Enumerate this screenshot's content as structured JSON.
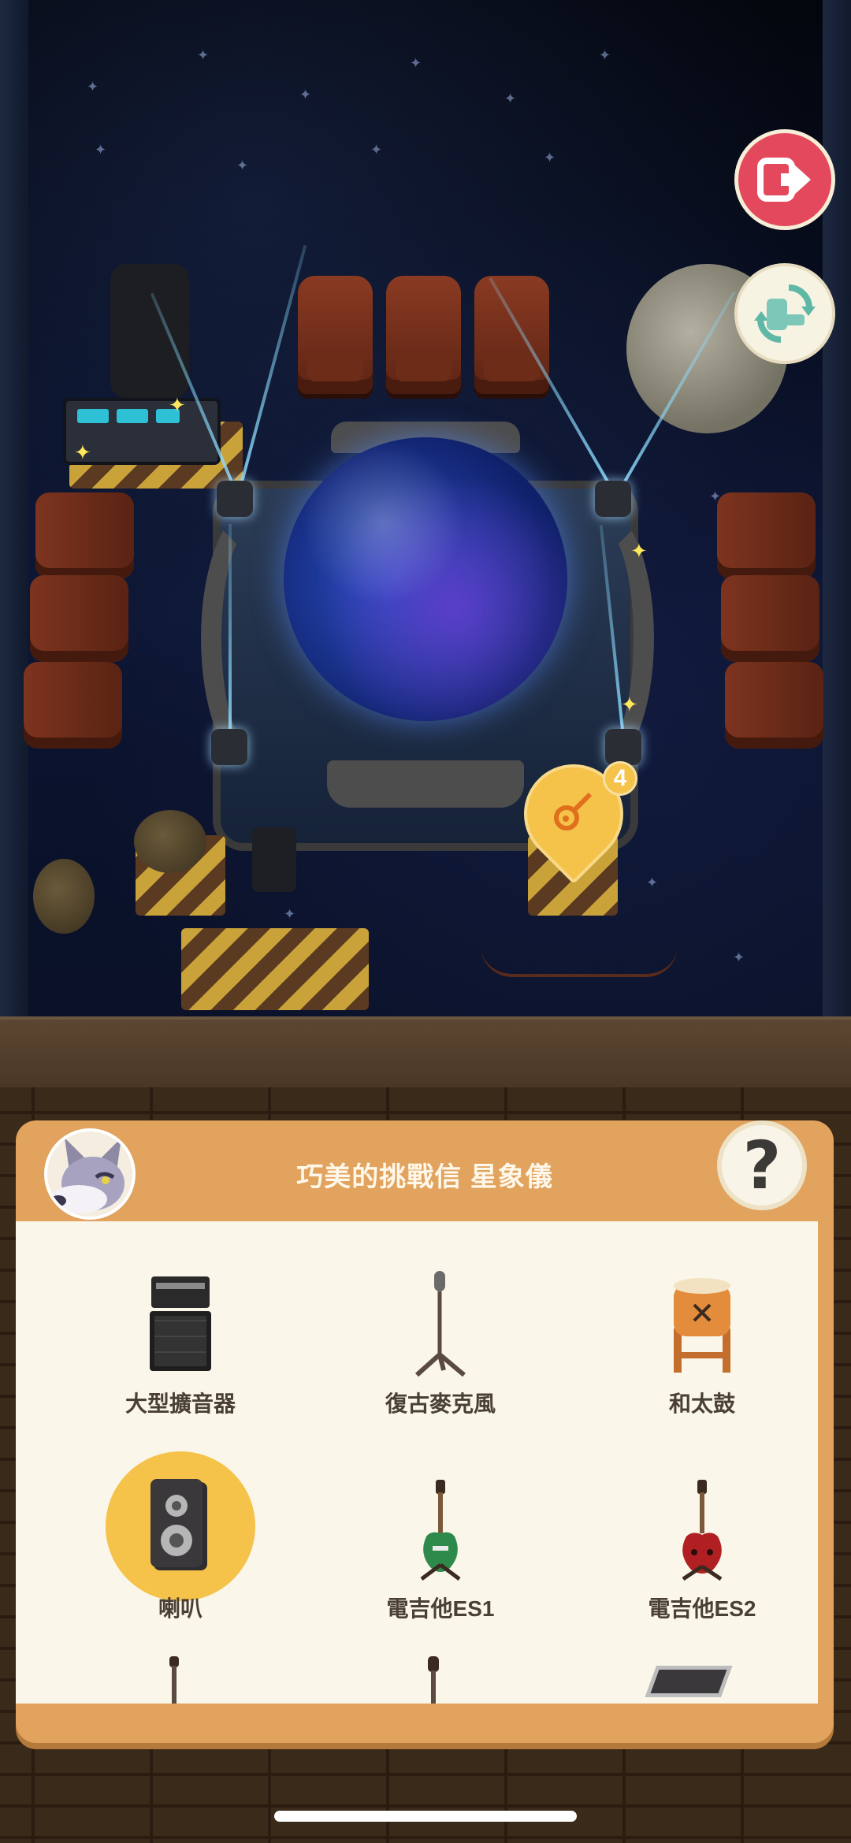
{
  "hud": {
    "exit_button": "exit-icon",
    "swap_button": "swap-furniture-icon",
    "notification_pin": {
      "icon": "guitar-icon",
      "count": "4"
    }
  },
  "panel": {
    "title": "巧美的挑戰信 星象儀",
    "avatar": "wolf-villager-avatar",
    "help_label": "?",
    "items": [
      {
        "label": "大型擴音器",
        "icon": "amplifier-icon",
        "selected": false
      },
      {
        "label": "復古麥克風",
        "icon": "microphone-icon",
        "selected": false
      },
      {
        "label": "和太鼓",
        "icon": "taiko-drum-icon",
        "selected": false
      },
      {
        "label": "喇叭",
        "icon": "speaker-icon",
        "selected": true
      },
      {
        "label": "電吉他ES1",
        "icon": "green-guitar-icon",
        "selected": false
      },
      {
        "label": "電吉他ES2",
        "icon": "red-guitar-icon",
        "selected": false
      }
    ]
  },
  "colors": {
    "panel": "#e1a35e",
    "panel_body": "#faf6e9",
    "exit": "#e3485c",
    "selected": "#f5c24a"
  }
}
